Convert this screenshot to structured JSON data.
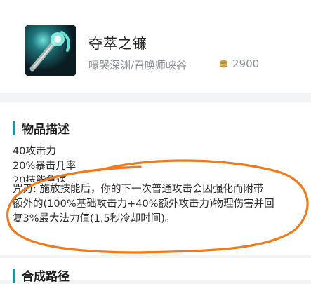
{
  "item": {
    "name": "夺萃之镰",
    "maps": "嚎哭深渊/召唤师峡谷",
    "price": "2900",
    "icon": "scythe-icon",
    "currency_icon": "coin-icon"
  },
  "description": {
    "title": "物品描述",
    "stats": [
      "40攻击力",
      "20%暴击几率",
      "20技能急速"
    ],
    "passive_lines": [
      "咒刃: 施放技能后，你的下一次普通攻击会因强化而附带",
      "额外的(100%基础攻击力+40%额外攻击力)物理伤害并回",
      "复3%最大法力值(1.5秒冷却时间)。"
    ]
  },
  "build_path": {
    "title": "合成路径"
  },
  "colors": {
    "accent": "#1f8fa8",
    "annotation": "#f07a1c",
    "background": "#f3f4f6",
    "muted_text": "#8b8f96"
  }
}
